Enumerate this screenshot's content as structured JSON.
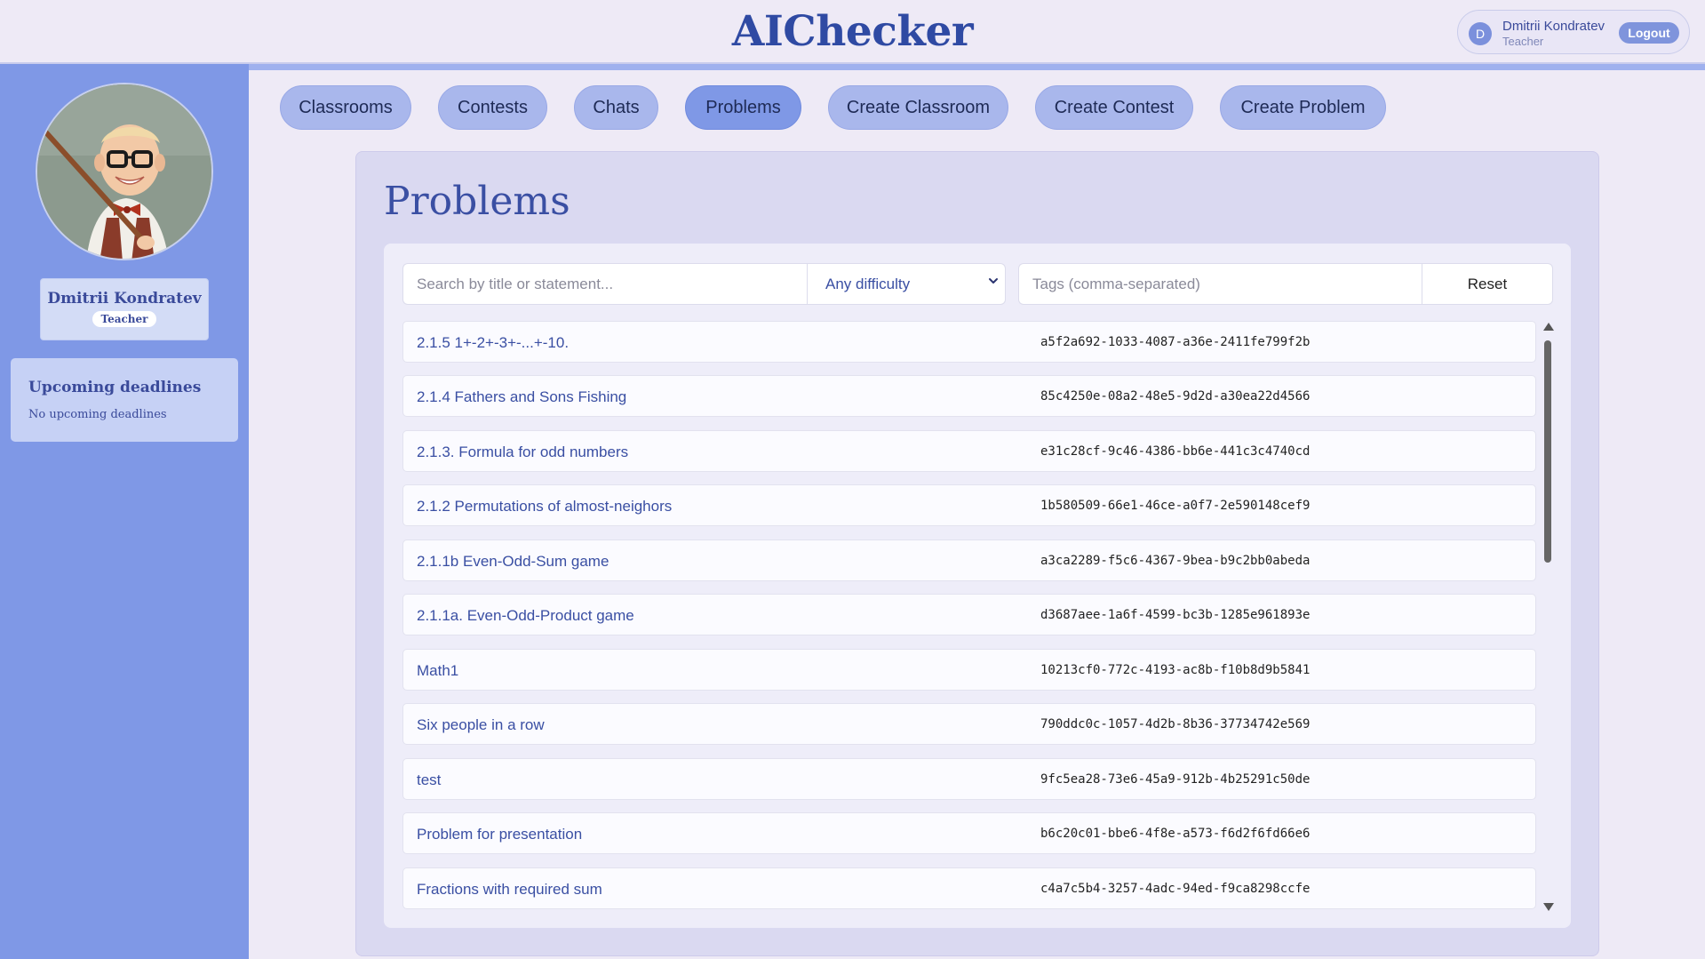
{
  "app": {
    "title": "AIChecker"
  },
  "user": {
    "initial": "D",
    "name": "Dmitrii Kondratev",
    "role": "Teacher",
    "logout_label": "Logout"
  },
  "sidebar": {
    "profile_name": "Dmitrii Kondratev",
    "profile_role": "Teacher",
    "deadlines_title": "Upcoming deadlines",
    "deadlines_empty": "No upcoming deadlines"
  },
  "nav": {
    "tabs": [
      {
        "label": "Classrooms"
      },
      {
        "label": "Contests"
      },
      {
        "label": "Chats"
      },
      {
        "label": "Problems"
      },
      {
        "label": "Create Classroom"
      },
      {
        "label": "Create Contest"
      },
      {
        "label": "Create Problem"
      }
    ],
    "active": "Problems"
  },
  "main": {
    "title": "Problems",
    "filters": {
      "search_placeholder": "Search by title or statement...",
      "difficulty_value": "Any difficulty",
      "tags_placeholder": "Tags (comma-separated)",
      "reset_label": "Reset"
    },
    "problems": [
      {
        "title": "2.1.5 1+-2+-3+-...+-10.",
        "id": "a5f2a692-1033-4087-a36e-2411fe799f2b"
      },
      {
        "title": "2.1.4 Fathers and Sons Fishing",
        "id": "85c4250e-08a2-48e5-9d2d-a30ea22d4566"
      },
      {
        "title": "2.1.3. Formula for odd numbers",
        "id": "e31c28cf-9c46-4386-bb6e-441c3c4740cd"
      },
      {
        "title": "2.1.2 Permutations of almost-neighors",
        "id": "1b580509-66e1-46ce-a0f7-2e590148cef9"
      },
      {
        "title": "2.1.1b Even-Odd-Sum game",
        "id": "a3ca2289-f5c6-4367-9bea-b9c2bb0abeda"
      },
      {
        "title": "2.1.1a. Even-Odd-Product game",
        "id": "d3687aee-1a6f-4599-bc3b-1285e961893e"
      },
      {
        "title": "Math1",
        "id": "10213cf0-772c-4193-ac8b-f10b8d9b5841"
      },
      {
        "title": "Six people in a row",
        "id": "790ddc0c-1057-4d2b-8b36-37734742e569"
      },
      {
        "title": "test",
        "id": "9fc5ea28-73e6-45a9-912b-4b25291c50de"
      },
      {
        "title": "Problem for presentation",
        "id": "b6c20c01-bbe6-4f8e-a573-f6d2f6fd66e6"
      },
      {
        "title": "Fractions with required sum",
        "id": "c4a7c5b4-3257-4adc-94ed-f9ca8298ccfe"
      }
    ]
  },
  "colors": {
    "sidebar": "#7f98e6",
    "accent": "#3a4fa3",
    "tab": "#a9b7ec",
    "tab_active": "#7f98e6"
  }
}
